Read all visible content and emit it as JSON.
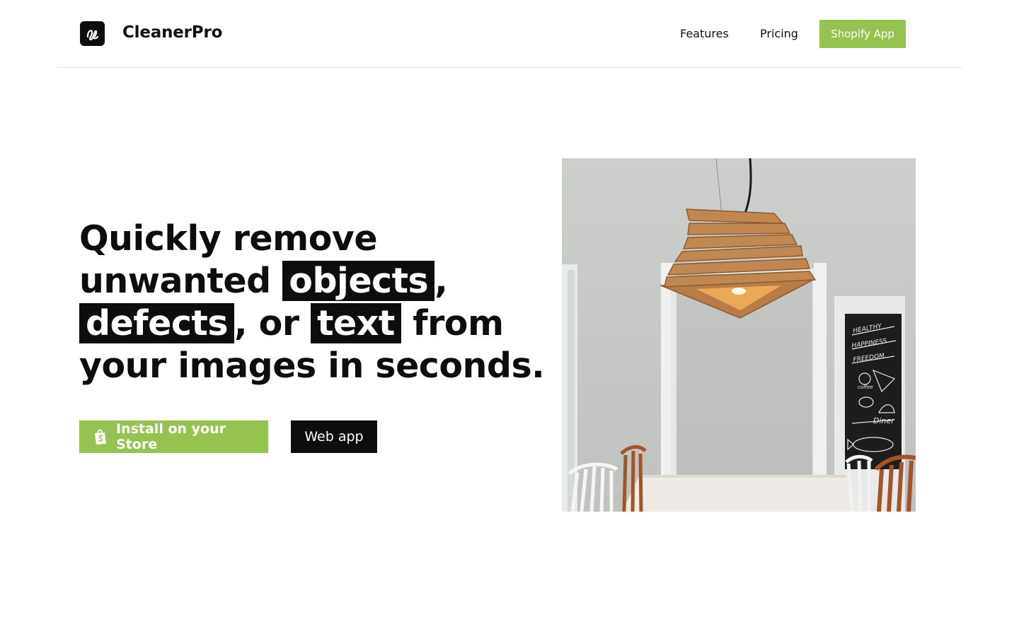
{
  "header": {
    "brand": "CleanerPro",
    "nav": {
      "features": "Features",
      "pricing": "Pricing",
      "cta": "Shopify App"
    }
  },
  "hero": {
    "headline": {
      "line1": "Quickly remove",
      "line2_pre": "unwanted ",
      "hl1": "objects",
      "line2_post": ",",
      "hl2": "defects",
      "line3_mid": ", or ",
      "hl3": "text",
      "line3_post": " from",
      "line4": "your images in seconds."
    },
    "install_button": "Install on your Store",
    "webapp_button": "Web app"
  },
  "image": {
    "chalkboard": [
      "HEALTHY",
      "HAPPINESS",
      "FREEDOM",
      "coffee",
      "Diner"
    ]
  },
  "colors": {
    "accent": "#96c24f",
    "dark": "#0d0d0d"
  },
  "icons": {
    "logo": "logo-icon",
    "install": "shopping-bag-icon"
  }
}
